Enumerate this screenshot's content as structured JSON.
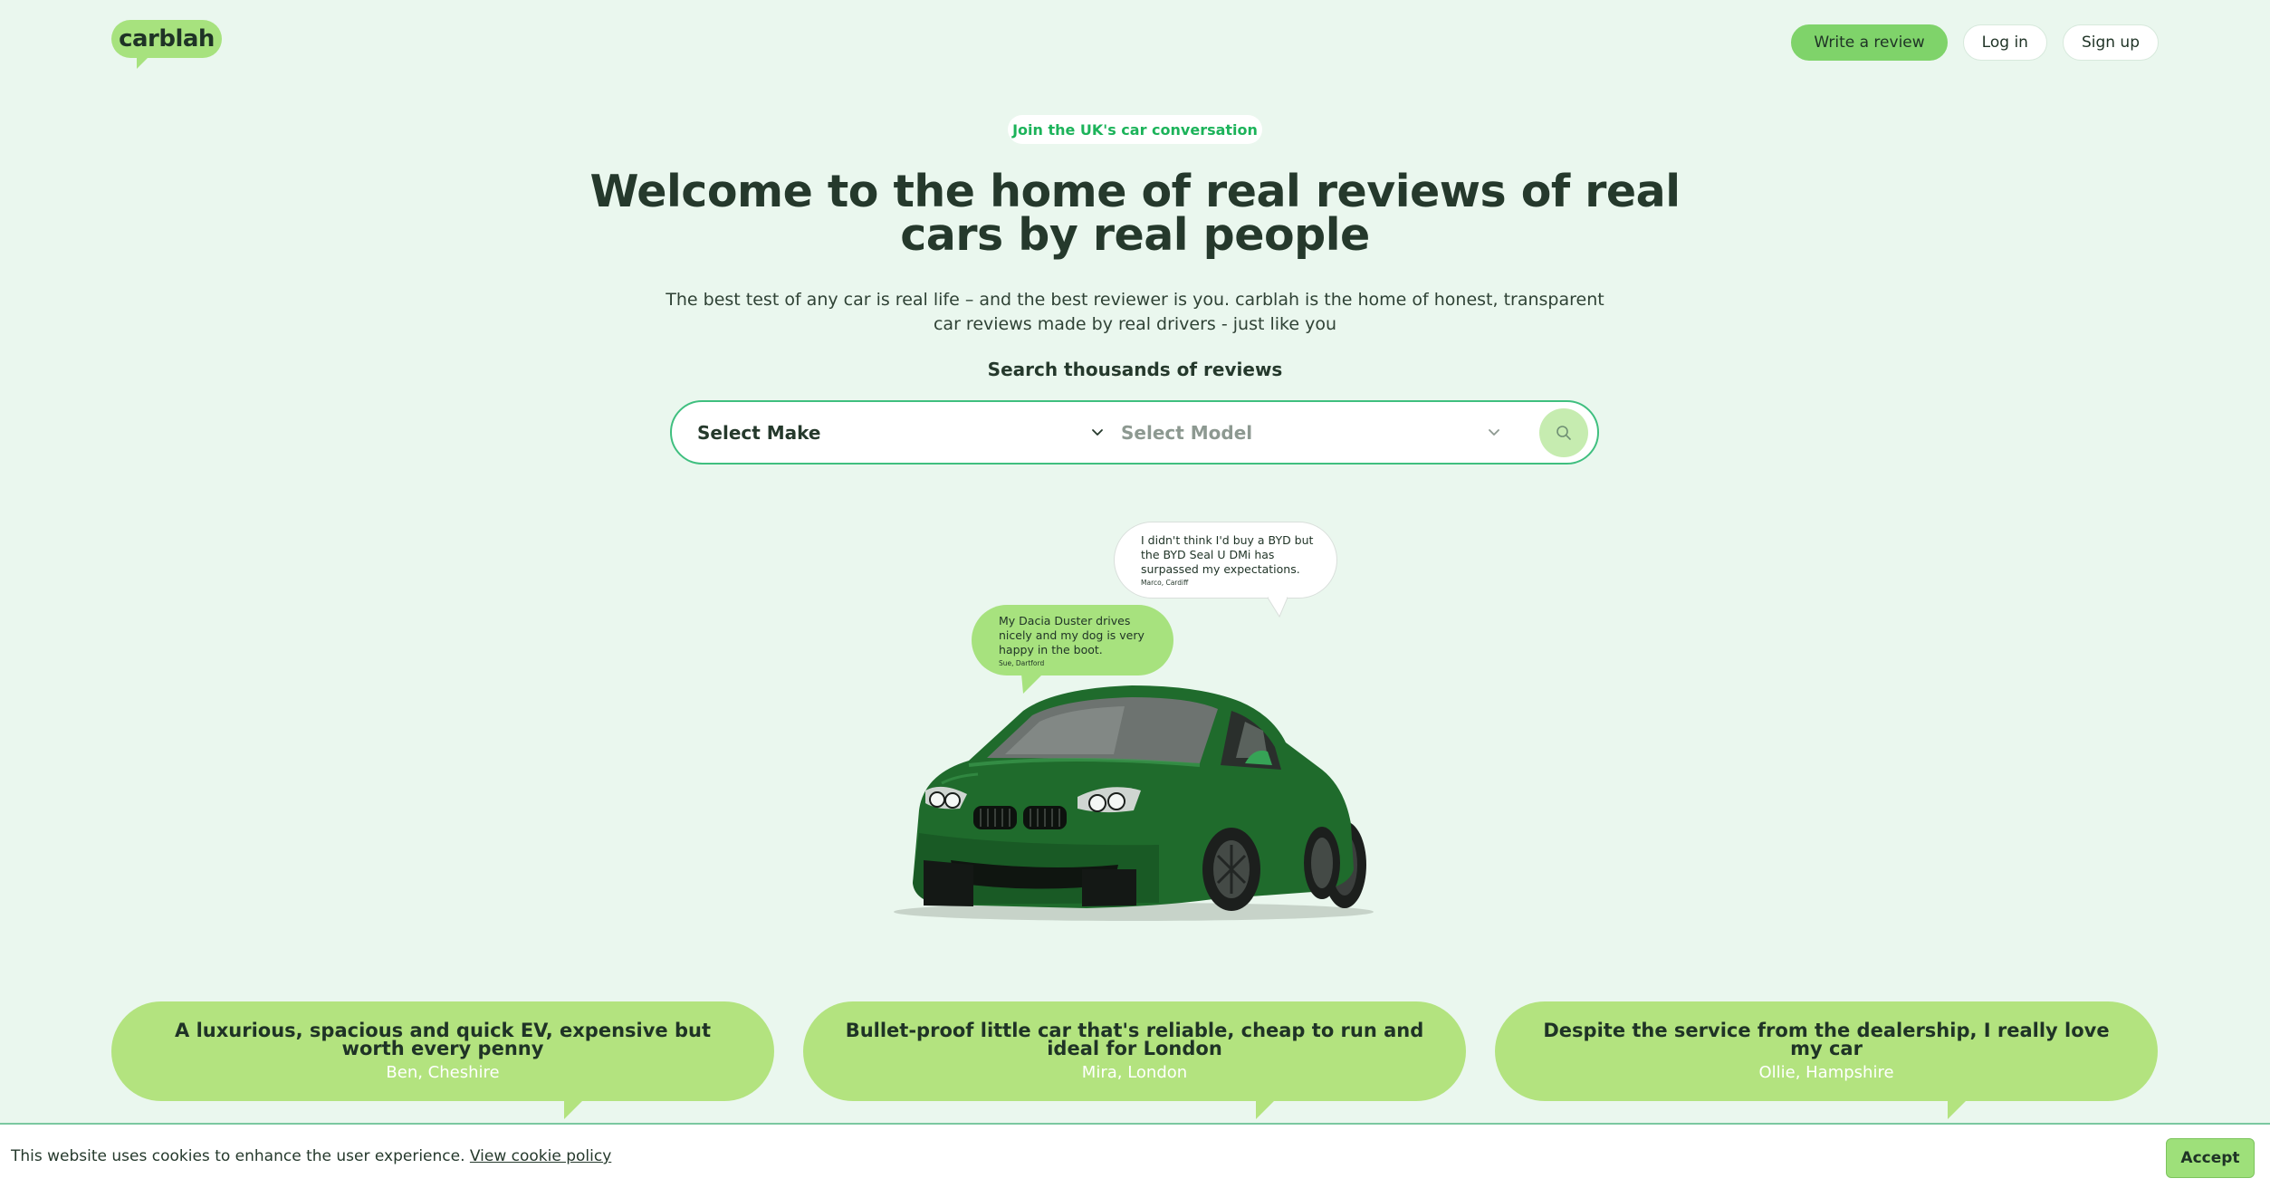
{
  "header": {
    "logo_text": "carblah",
    "nav": {
      "write_review": "Write a review",
      "log_in": "Log in",
      "sign_up": "Sign up"
    }
  },
  "hero": {
    "pill": "Join the UK's car conversation",
    "headline": "Welcome to the home of real reviews of real cars by real people",
    "subtext": "The best test of any car is real life – and the best reviewer is you. carblah is the home of honest, transparent car reviews made by real drivers - just like you",
    "search_title": "Search thousands of reviews",
    "search": {
      "make_label": "Select Make",
      "model_label": "Select Model",
      "icons": {
        "chevron": "chevron-down-icon",
        "search": "search-icon"
      }
    }
  },
  "bubbles": [
    {
      "quote": "I didn't think I'd buy a BYD but the BYD Seal U DMi has surpassed my expectations.",
      "who": "Marco, Cardiff"
    },
    {
      "quote": "My Dacia Duster drives nicely and my dog is very happy in the boot.",
      "who": "Sue, Dartford"
    }
  ],
  "reviews": [
    {
      "title": "A luxurious, spacious and quick EV, expensive but worth every penny",
      "author": "Ben, Cheshire"
    },
    {
      "title": "Bullet-proof little car that's reliable, cheap to run and ideal for London",
      "author": "Mira, London"
    },
    {
      "title": "Despite the service from the dealership, I really love my car",
      "author": "Ollie, Hampshire"
    }
  ],
  "cookie": {
    "text": "This website uses cookies to enhance the user experience.",
    "link": "View cookie policy",
    "accept": "Accept"
  },
  "colors": {
    "background": "#eaf7ee",
    "brand_green": "#a7e27e",
    "accent_text": "#1cb35a",
    "card_green": "#b3e37f",
    "car_green": "#1f6b2c"
  }
}
